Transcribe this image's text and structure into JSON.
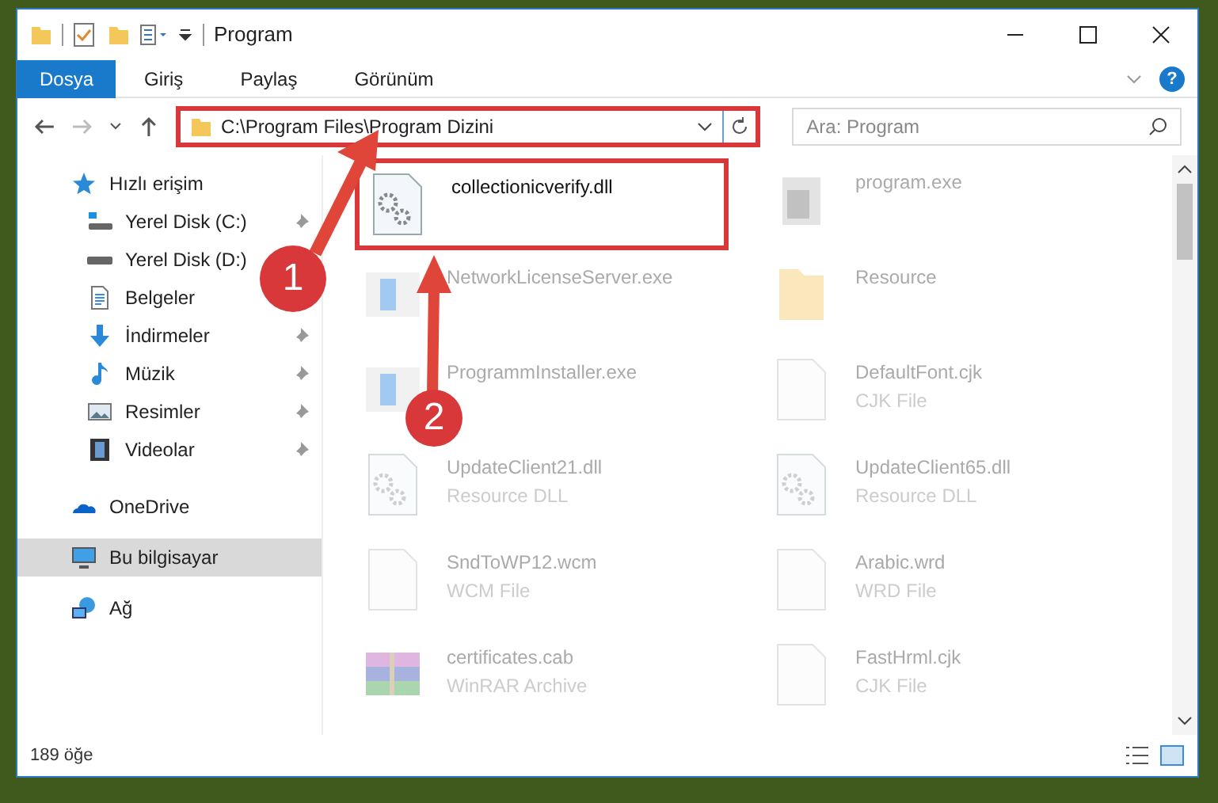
{
  "window": {
    "title": "Program"
  },
  "ribbon_tabs": [
    {
      "label": "Dosya",
      "selected": true
    },
    {
      "label": "Giriş",
      "selected": false
    },
    {
      "label": "Paylaş",
      "selected": false
    },
    {
      "label": "Görünüm",
      "selected": false
    }
  ],
  "help": {
    "label": "?"
  },
  "address": {
    "path": "C:\\Program Files\\Program Dizini",
    "highlighted": true
  },
  "search": {
    "placeholder": "Ara: Program"
  },
  "sidebar": {
    "items": [
      {
        "label": "Hızlı erişim",
        "kind": "star",
        "pinned": false,
        "selected": false,
        "children": [
          {
            "label": "Yerel Disk (C:)",
            "kind": "disk-c",
            "pinned": true,
            "selected": false
          },
          {
            "label": "Yerel Disk (D:)",
            "kind": "disk",
            "selected": false
          },
          {
            "label": "Belgeler",
            "kind": "docs",
            "selected": false
          },
          {
            "label": "İndirmeler",
            "kind": "download",
            "pinned": true,
            "selected": false
          },
          {
            "label": "Müzik",
            "kind": "music",
            "pinned": true,
            "selected": false
          },
          {
            "label": "Resimler",
            "kind": "pictures",
            "pinned": true,
            "selected": false
          },
          {
            "label": "Videolar",
            "kind": "videos",
            "pinned": true,
            "selected": false
          }
        ]
      },
      {
        "label": "OneDrive",
        "kind": "cloud",
        "pinned": false,
        "selected": false
      },
      {
        "label": "Bu bilgisayar",
        "kind": "pc",
        "pinned": false,
        "selected": true
      },
      {
        "label": "Ağ",
        "kind": "network",
        "pinned": false,
        "selected": false
      }
    ]
  },
  "files": [
    {
      "name": "collectionicverify.dll",
      "kind": "dll",
      "highlighted": true
    },
    {
      "name": "program.exe",
      "kind": "exe",
      "highlighted": false
    },
    {
      "name": "NetworkLicenseServer.exe",
      "kind": "app",
      "highlighted": false
    },
    {
      "name": "Resource",
      "kind": "folder",
      "highlighted": false
    },
    {
      "name": "ProgrammInstaller.exe",
      "kind": "app",
      "highlighted": false
    },
    {
      "name": "DefaultFont.cjk",
      "type": "CJK File",
      "kind": "file",
      "highlighted": false
    },
    {
      "name": "UpdateClient21.dll",
      "type": "Resource DLL",
      "kind": "dll",
      "highlighted": false
    },
    {
      "name": "UpdateClient65.dll",
      "type": "Resource DLL",
      "kind": "dll",
      "highlighted": false
    },
    {
      "name": "SndToWP12.wcm",
      "type": "WCM File",
      "kind": "file",
      "highlighted": false
    },
    {
      "name": "Arabic.wrd",
      "type": "WRD File",
      "kind": "file",
      "highlighted": false
    },
    {
      "name": "certificates.cab",
      "type": "WinRAR Archive",
      "kind": "archive",
      "highlighted": false
    },
    {
      "name": "FastHrml.cjk",
      "type": "CJK File",
      "kind": "file",
      "highlighted": false
    }
  ],
  "status_bar": {
    "count": "189 öğe"
  },
  "callouts": [
    {
      "label": "1"
    },
    {
      "label": "2"
    }
  ]
}
